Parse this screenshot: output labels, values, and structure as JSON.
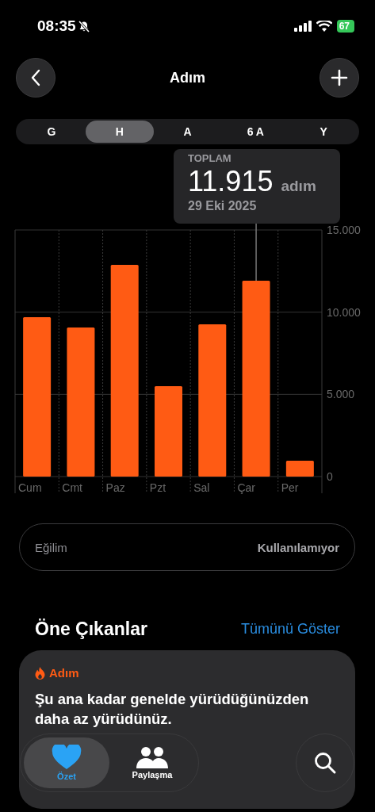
{
  "status_bar": {
    "time": "08:35",
    "battery": "67"
  },
  "nav": {
    "title": "Adım"
  },
  "ranges": [
    {
      "label": "G",
      "selected": false
    },
    {
      "label": "H",
      "selected": true
    },
    {
      "label": "A",
      "selected": false
    },
    {
      "label": "6 A",
      "selected": false
    },
    {
      "label": "Y",
      "selected": false
    }
  ],
  "selection": {
    "label": "TOPLAM",
    "value": "11.915",
    "unit": "adım",
    "date": "29 Eki 2025"
  },
  "chart_data": {
    "type": "bar",
    "categories": [
      "Cum",
      "Cmt",
      "Paz",
      "Pzt",
      "Sal",
      "Çar",
      "Per"
    ],
    "series": [
      {
        "color": "#ff5b14",
        "values": [
          9700,
          9070,
          12880,
          5500,
          9260,
          11915,
          960
        ]
      }
    ],
    "ylim": [
      0,
      15000
    ],
    "yticks": [
      {
        "value": 0,
        "label": "0"
      },
      {
        "value": 5000,
        "label": "5.000"
      },
      {
        "value": 10000,
        "label": "10.000"
      },
      {
        "value": 15000,
        "label": "15.000"
      }
    ]
  },
  "trend": {
    "label": "Eğilim",
    "value": "Kullanılamıyor"
  },
  "highlights": {
    "title": "Öne Çıkanlar",
    "link": "Tümünü Göster",
    "card": {
      "category": "Adım",
      "text": "Şu ana kadar genelde yürüdüğünüzden daha az yürüdünüz."
    }
  },
  "tabs": [
    {
      "label": "Özet",
      "selected": true
    },
    {
      "label": "Paylaşma",
      "selected": false
    }
  ]
}
